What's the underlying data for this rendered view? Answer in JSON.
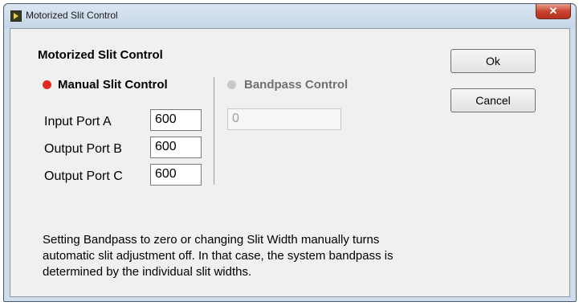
{
  "window": {
    "title": "Motorized Slit Control",
    "close_glyph": "✕"
  },
  "dialog": {
    "heading": "Motorized Slit Control",
    "manual": {
      "label": "Manual Slit Control",
      "selected": true,
      "indicator_color": "#e02a1c",
      "fields": [
        {
          "label": "Input Port A",
          "value": "600"
        },
        {
          "label": "Output Port B",
          "value": "600"
        },
        {
          "label": "Output Port C",
          "value": "600"
        }
      ]
    },
    "bandpass": {
      "label": "Bandpass Control",
      "selected": false,
      "indicator_color": "#c8c8c8",
      "value": "0"
    },
    "buttons": {
      "ok": "Ok",
      "cancel": "Cancel"
    },
    "info_text": "Setting Bandpass to zero or changing Slit Width manually turns automatic slit adjustment off.  In that case, the system bandpass is determined  by the individual slit widths."
  }
}
